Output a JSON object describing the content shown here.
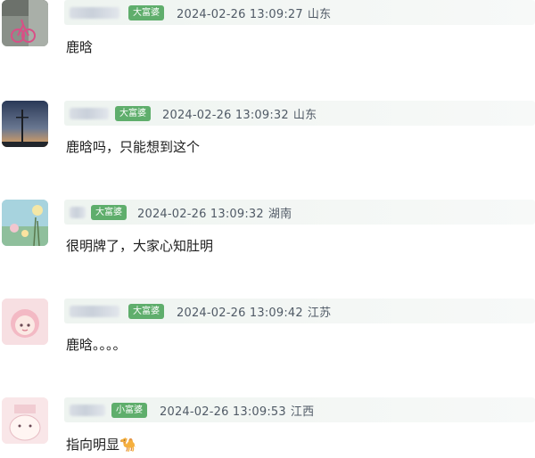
{
  "comments": [
    {
      "badge": "大富婆",
      "time": "2024-02-26 13:09:27",
      "location": "山东",
      "text": "鹿晗"
    },
    {
      "badge": "大富婆",
      "time": "2024-02-26 13:09:32",
      "location": "山东",
      "text": "鹿晗吗，只能想到这个"
    },
    {
      "badge": "大富婆",
      "time": "2024-02-26 13:09:32",
      "location": "湖南",
      "text": "很明牌了，大家心知肚明"
    },
    {
      "badge": "大富婆",
      "time": "2024-02-26 13:09:42",
      "location": "江苏",
      "text": "鹿晗。。。。"
    },
    {
      "badge": "小富婆",
      "time": "2024-02-26 13:09:53",
      "location": "江西",
      "text": "指向明显🐪"
    }
  ],
  "colors": {
    "badge": "#5fae6c",
    "meta_bar": "#eef4f0",
    "meta_text": "#505a66",
    "body_text": "#1d1d1d"
  }
}
